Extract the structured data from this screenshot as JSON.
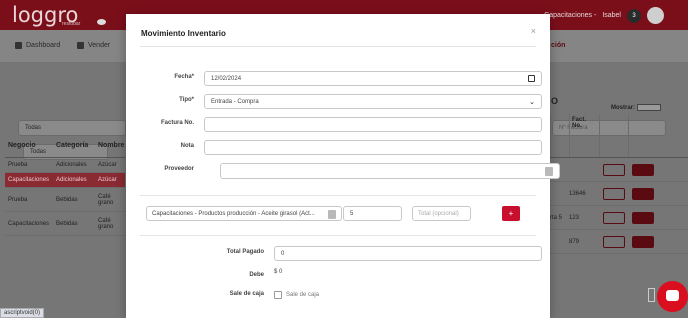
{
  "app": {
    "logo_text": "loggro",
    "logo_sub": "restobar",
    "header_company": "Capacitaciones -",
    "header_user": "Isabel",
    "notification_count": "3"
  },
  "nav": {
    "items": [
      {
        "label": "Dashboard",
        "icon": "dashboard-icon"
      },
      {
        "label": "Vender",
        "icon": "cart-icon"
      }
    ],
    "right_label": "ción"
  },
  "background": {
    "filter_select_1": "Todas",
    "filter_select_2": "Todas",
    "factura_placeholder": "Nº Factura",
    "page_letter": "O",
    "mostrar_label": "Mostrar:",
    "left_columns": [
      "Negocio",
      "Categoría",
      "Nombre"
    ],
    "left_rows": [
      {
        "negocio": "Prueba",
        "categoria": "Adicionales",
        "nombre": "Azúcar"
      },
      {
        "negocio": "Capacitaciones",
        "categoria": "Adicionales",
        "nombre": "Azúcar"
      },
      {
        "negocio": "Prueba",
        "categoria": "Bebidas",
        "nombre": "Café grano"
      },
      {
        "negocio": "Capacitaciones",
        "categoria": "Bebidas",
        "nombre": "Café grano"
      }
    ],
    "right_columns": [
      "Fact. No."
    ],
    "right_rows": [
      {
        "a": "",
        "fact": ""
      },
      {
        "a": "",
        "fact": "13646"
      },
      {
        "a": "rta 5",
        "fact": "123"
      },
      {
        "a": "",
        "fact": "879"
      }
    ],
    "status_tip": "ascriptvoid(0)"
  },
  "modal": {
    "title": "Movimiento Inventario",
    "close_glyph": "×",
    "fecha_label": "Fecha*",
    "fecha_value": "12/02/2024",
    "tipo_label": "Tipo*",
    "tipo_value": "Entrada - Compra",
    "factura_label": "Factura No.",
    "factura_value": "",
    "nota_label": "Nota",
    "nota_value": "",
    "proveedor_label": "Proveedor",
    "product_value": "Capacitaciones - Productos producción - Aceite girasol (Act...",
    "quantity_value": "5",
    "total_placeholder": "Total (opcional)",
    "add_label": "+",
    "total_pagado_label": "Total Pagado",
    "total_pagado_value": "0",
    "debe_label": "Debe",
    "debe_value": "$ 0",
    "sale_caja_label": "Sale de caja",
    "sale_caja_checkbox_label": "Sale de caja"
  }
}
